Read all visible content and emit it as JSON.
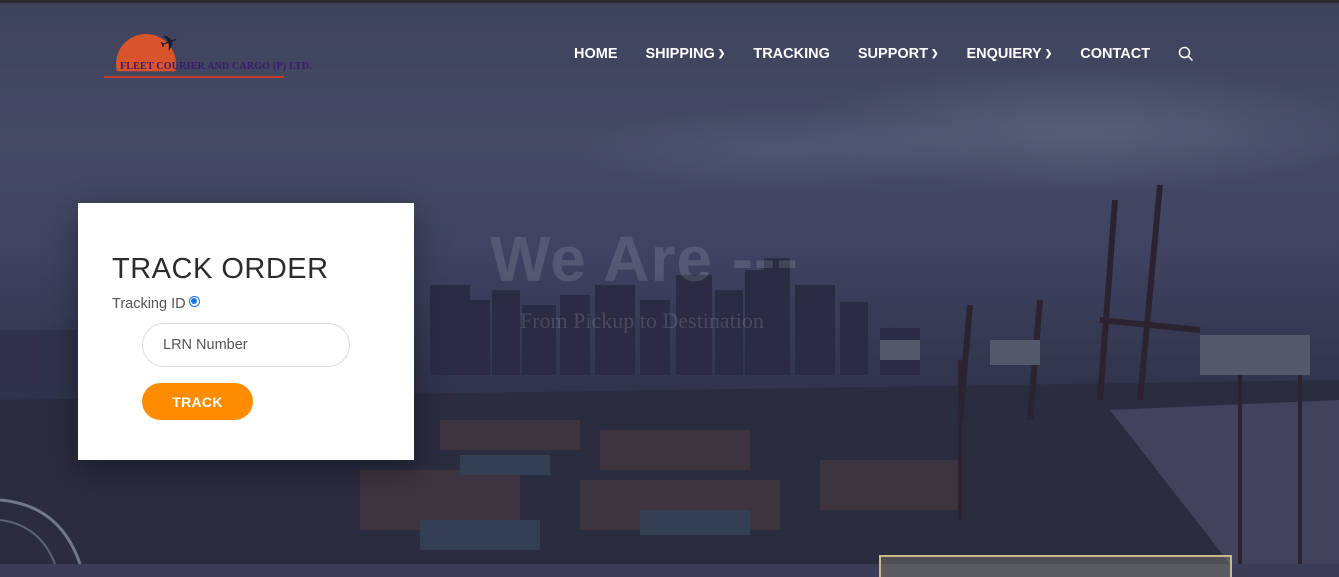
{
  "brand": {
    "logo_text": "FLEET COURIER AND CARGO (P) LTD."
  },
  "nav": {
    "items": [
      {
        "label": "HOME",
        "has_dropdown": false
      },
      {
        "label": "SHIPPING",
        "has_dropdown": true
      },
      {
        "label": "TRACKING",
        "has_dropdown": false
      },
      {
        "label": "SUPPORT",
        "has_dropdown": true
      },
      {
        "label": "ENQUIERY",
        "has_dropdown": true
      },
      {
        "label": "CONTACT",
        "has_dropdown": false
      }
    ],
    "search_icon": "search-icon"
  },
  "hero": {
    "title": "We Are ---",
    "subtitle": "From Pickup to Destination"
  },
  "track": {
    "title": "TRACK ORDER",
    "tracking_label": "Tracking ID",
    "tracking_selected": true,
    "input_placeholder": "LRN Number",
    "input_value": "",
    "button_label": "TRACK"
  },
  "colors": {
    "accent": "#ff8c00",
    "radio": "#1a73e8",
    "logo_sun": "#d9532b"
  }
}
